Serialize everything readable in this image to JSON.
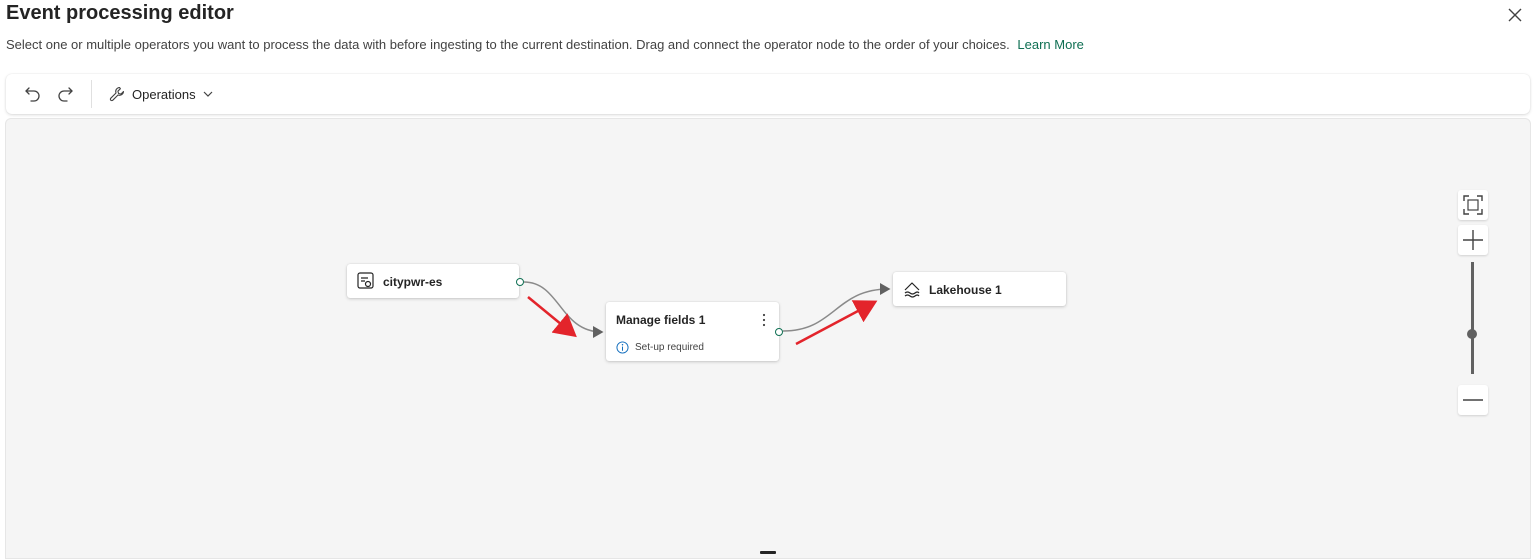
{
  "header": {
    "title": "Event processing editor",
    "description": "Select one or multiple operators you want to process the data with before ingesting to the current destination. Drag and connect the operator node to the order of your choices.",
    "learn_more": "Learn More",
    "close_icon": "close-icon"
  },
  "toolbar": {
    "undo_icon": "undo-icon",
    "redo_icon": "redo-icon",
    "operations_label": "Operations",
    "operations_icon": "wrench-icon"
  },
  "canvas": {
    "nodes": {
      "source": {
        "label": "citypwr-es",
        "icon": "eventstream-icon"
      },
      "operator": {
        "label": "Manage fields 1",
        "status": "Set-up required",
        "status_icon": "info-icon",
        "more_icon": "more-vertical-icon"
      },
      "destination": {
        "label": "Lakehouse 1",
        "icon": "lakehouse-icon"
      }
    },
    "zoom_controls": {
      "fit_icon": "fit-to-screen-icon",
      "zoom_in_icon": "plus-icon",
      "zoom_out_icon": "minus-icon"
    }
  },
  "colors": {
    "accent": "#0f6f53",
    "arrow_annotation": "#e3242b",
    "canvas_bg": "#f5f5f5"
  }
}
